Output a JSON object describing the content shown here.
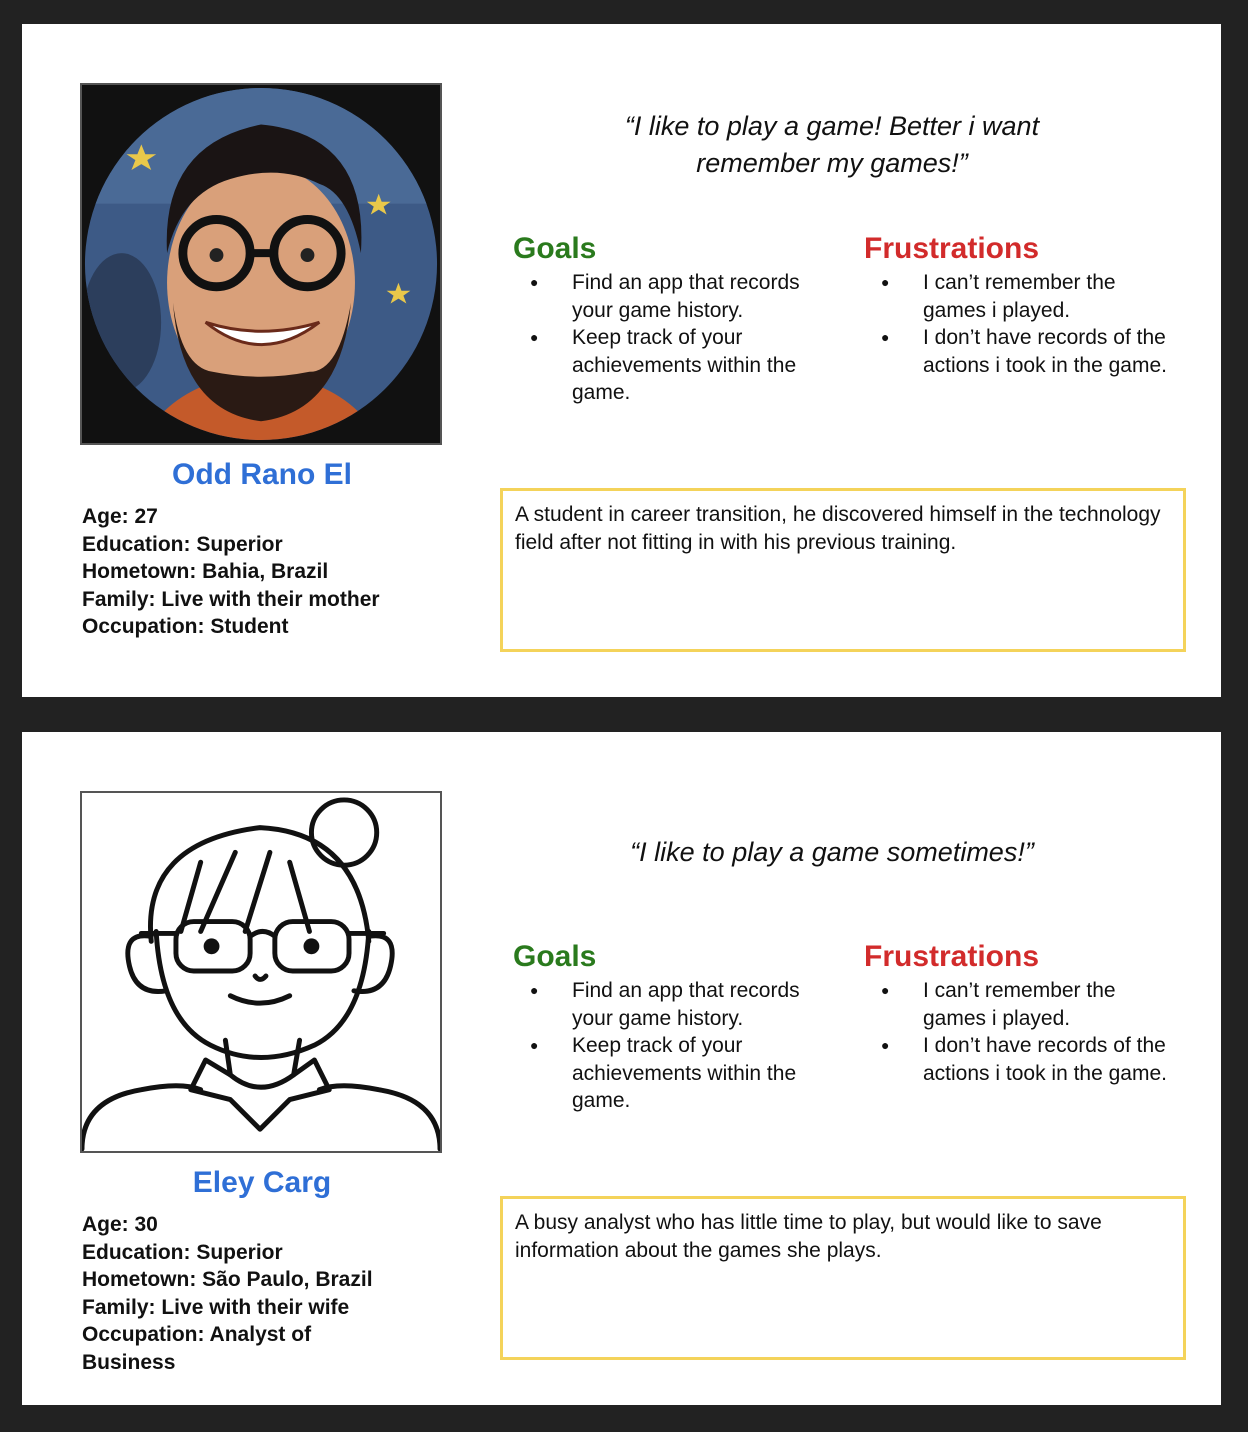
{
  "personas": [
    {
      "name": "Odd Rano El",
      "quote": "“I like to play a game! Better i want remember my games!”",
      "goals_title": "Goals",
      "goals": [
        "Find an app that records your game history.",
        "Keep track of your achievements within the game."
      ],
      "frustrations_title": "Frustrations",
      "frustrations": [
        "I can’t remember the games i played.",
        "I don’t have records of the actions i took in the game."
      ],
      "info": {
        "age": "Age: 27",
        "education": "Education: Superior",
        "hometown": "Hometown: Bahia, Brazil",
        "family": "Family: Live with their mother",
        "occupation": "Occupation: Student"
      },
      "bio": "A student in career transition, he discovered himself in the technology field after not fitting in with his previous training."
    },
    {
      "name": "Eley Carg",
      "quote": "“I like to play a game sometimes!”",
      "goals_title": "Goals",
      "goals": [
        "Find an app that records your game history.",
        "Keep track of your achievements within the game."
      ],
      "frustrations_title": "Frustrations",
      "frustrations": [
        "I can’t remember the games i played.",
        "I don’t have records of the actions i took in the game."
      ],
      "info": {
        "age": "Age: 30",
        "education": "Education: Superior",
        "hometown": "Hometown: São Paulo, Brazil",
        "family": "Family: Live with their wife",
        "occupation": "Occupation: Analyst of Business"
      },
      "bio": "A busy analyst who has little time to play, but would like to save information about the games she plays."
    }
  ],
  "colors": {
    "name": "#2f6fd6",
    "goals": "#2a7a1d",
    "frustrations": "#d22b2b",
    "bio_border": "#f4d35a",
    "page_background": "#222222"
  }
}
